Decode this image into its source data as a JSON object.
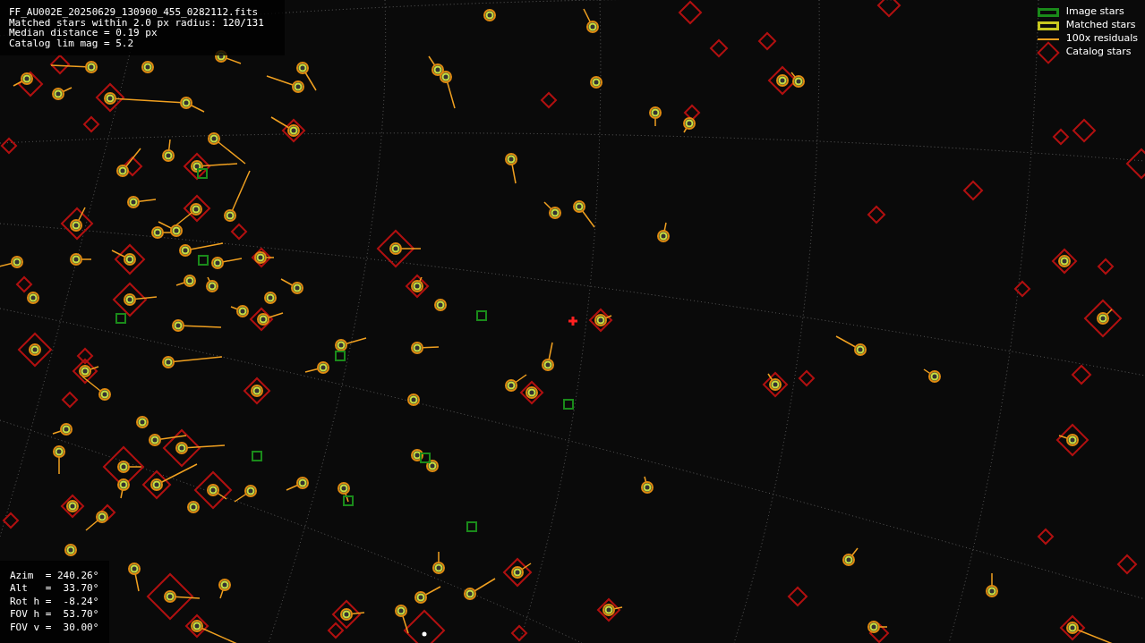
{
  "header": {
    "lines": [
      "FF_AU002E_20250629_130900_455_0282112.fits",
      "Matched stars within 2.0 px radius: 120/131",
      "Median distance = 0.19 px",
      "Catalog lim mag = 5.2"
    ]
  },
  "legend": [
    {
      "kind": "image",
      "label": "Image stars"
    },
    {
      "kind": "matched",
      "label": "Matched stars"
    },
    {
      "kind": "residual",
      "label": "100x residuals"
    },
    {
      "kind": "catalog",
      "label": "Catalog stars"
    }
  ],
  "pointing": {
    "lines": [
      "Azim  = 240.26°",
      "Alt   =  33.70°",
      "Rot h =  -8.24°",
      "FOV h =  53.70°",
      "FOV v =  30.00°"
    ]
  }
}
